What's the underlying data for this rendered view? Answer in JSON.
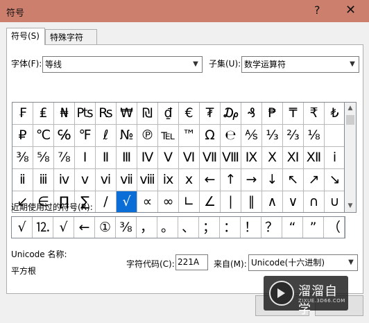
{
  "window": {
    "title": "符号",
    "help_label": "?",
    "close_label": "✕"
  },
  "tabs": [
    {
      "label": "符号(S)"
    },
    {
      "label": "特殊字符(P)"
    }
  ],
  "font_row": {
    "font_label": "字体(F):",
    "font_value": "等线",
    "subset_label": "子集(U):",
    "subset_value": "数学运算符"
  },
  "symbol_grid": {
    "selected": "√",
    "rows": [
      [
        "₣",
        "₤",
        "₦",
        "₧",
        "₨",
        "₩",
        "₪",
        "₫",
        "€",
        "₮",
        "₯",
        "₰",
        "₱",
        "₸",
        "₹",
        "₺"
      ],
      [
        "₽",
        "℃",
        "℅",
        "℉",
        "ℓ",
        "№",
        "℗",
        "℡",
        "™",
        "Ω",
        "℮",
        "⅍",
        "⅓",
        "⅔",
        "⅛",
        ""
      ],
      [
        "⅜",
        "⅝",
        "⅞",
        "Ⅰ",
        "Ⅱ",
        "Ⅲ",
        "Ⅳ",
        "Ⅴ",
        "Ⅵ",
        "Ⅶ",
        "Ⅷ",
        "Ⅸ",
        "Ⅹ",
        "Ⅺ",
        "Ⅻ",
        "ⅰ"
      ],
      [
        "ⅱ",
        "ⅲ",
        "ⅳ",
        "ⅴ",
        "ⅵ",
        "ⅶ",
        "ⅷ",
        "ⅸ",
        "ⅹ",
        "←",
        "↑",
        "→",
        "↓",
        "↖",
        "↗",
        "↘"
      ],
      [
        "↙",
        "∈",
        "∏",
        "∑",
        "∕",
        "√",
        "∝",
        "∞",
        "∟",
        "∠",
        "∣",
        "∥",
        "∧",
        "∨",
        "∩",
        "∪"
      ]
    ]
  },
  "recent": {
    "label": "近期使用过的符号(R):",
    "symbols": [
      "√",
      "⒓",
      "√",
      "←",
      "①",
      "⅜",
      "，",
      "。",
      "、",
      "；",
      "：",
      "！",
      "？",
      "“",
      "”",
      "（"
    ]
  },
  "info": {
    "unicode_name_label": "Unicode 名称:",
    "unicode_name_value": "平方根",
    "char_code_label": "字符代码(C):",
    "char_code_value": "221A",
    "from_label": "来自(M):",
    "from_value": "Unicode(十六进制)"
  },
  "watermark": {
    "brand": "溜溜自学",
    "url": "ZIXUE.3D66.COM"
  }
}
